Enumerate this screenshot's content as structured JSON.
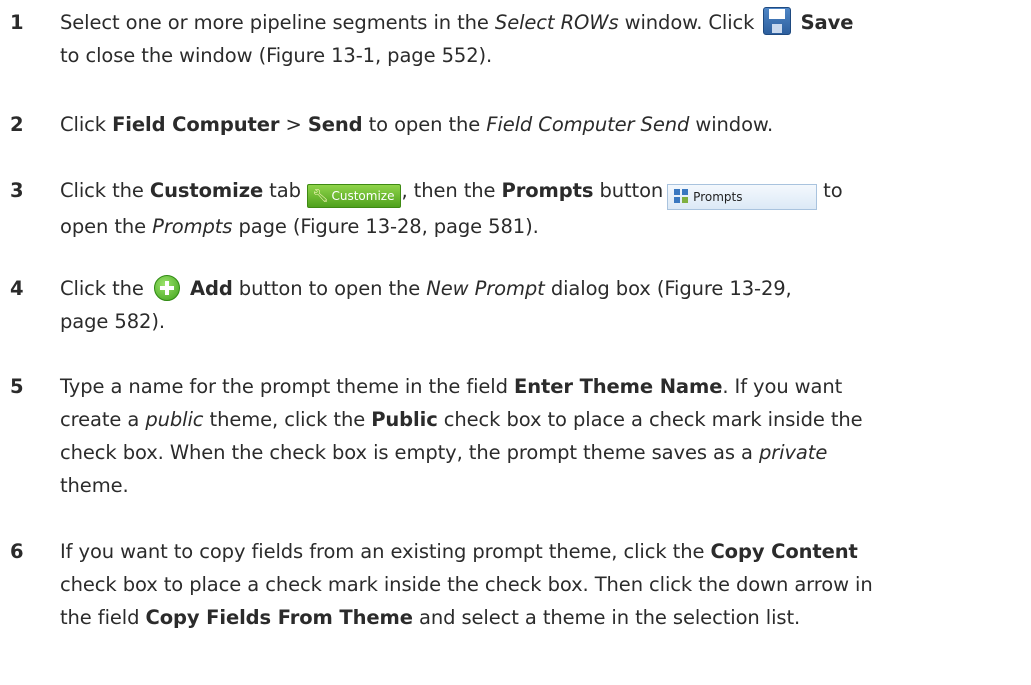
{
  "steps": [
    {
      "num": "1",
      "a": "Select one or more pipeline segments in the ",
      "b": "Select ROWs",
      "c": " window. Click ",
      "d": "Save",
      "e": "to close the window (Figure 13-1, page 552)."
    },
    {
      "num": "2",
      "a": "Click ",
      "b": "Field Computer",
      "c": " > ",
      "d": "Send",
      "e": " to open the ",
      "f": "Field Computer Send",
      "g": " window."
    },
    {
      "num": "3",
      "a": "Click the ",
      "b": "Customize",
      "c": " tab ",
      "tab_label": "Customize",
      "d": ", then the ",
      "e": "Prompts",
      "f": " button",
      "button_label": "Prompts",
      "g": "to",
      "h": "open the ",
      "i": "Prompts",
      "j": " page (Figure 13-28, page 581)."
    },
    {
      "num": "4",
      "a": "Click the ",
      "b": "Add",
      "c": " button to open the ",
      "d": "New Prompt",
      "e": " dialog box (Figure 13-29,",
      "f": "page 582)."
    },
    {
      "num": "5",
      "a": "Type a name for the prompt theme in the field ",
      "b": "Enter Theme Name",
      "c": ". If you want",
      "d": "create a ",
      "e": "public",
      "f": " theme, click the ",
      "g": "Public",
      "h": " check box to place a check mark inside the",
      "i": "check box. When the check box is empty, the prompt theme saves as a ",
      "j": "private",
      "k": "theme."
    },
    {
      "num": "6",
      "a": "If you want to copy fields from an existing prompt theme, click the ",
      "b": "Copy Content",
      "c": "check box to place a check mark inside the check box. Then click the down arrow in",
      "d": "the field ",
      "e": "Copy Fields From Theme",
      "f": " and select a theme in the selection list."
    }
  ]
}
